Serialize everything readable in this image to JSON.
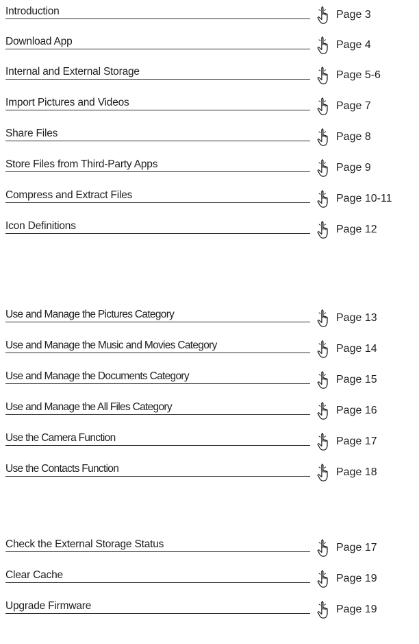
{
  "icon": "pointing-hand-icon",
  "groups": [
    {
      "entries": [
        {
          "title": "Introduction",
          "page": "Page 3"
        },
        {
          "title": "Download App",
          "page": "Page 4"
        },
        {
          "title": "Internal and External Storage",
          "page": "Page 5-6"
        },
        {
          "title": "Import Pictures and Videos",
          "page": "Page 7"
        },
        {
          "title": "Share Files",
          "page": "Page 8"
        },
        {
          "title": "Store Files from Third-Party Apps",
          "page": "Page 9"
        },
        {
          "title": "Compress and Extract Files",
          "page": "Page 10-11"
        },
        {
          "title": "Icon Definitions",
          "page": "Page 12"
        }
      ]
    },
    {
      "entries": [
        {
          "title": "Use and Manage the Pictures Category",
          "page": "Page 13"
        },
        {
          "title": "Use and Manage the Music and Movies Category",
          "page": "Page 14"
        },
        {
          "title": "Use and Manage the Documents Category",
          "page": "Page 15"
        },
        {
          "title": "Use and Manage the All Files Category",
          "page": "Page 16"
        },
        {
          "title": "Use the Camera Function",
          "page": "Page 17"
        },
        {
          "title": "Use the Contacts Function",
          "page": "Page 18"
        }
      ]
    },
    {
      "entries": [
        {
          "title": "Check the External Storage Status",
          "page": "Page 17"
        },
        {
          "title": "Clear Cache",
          "page": "Page 19"
        },
        {
          "title": "Upgrade Firmware",
          "page": "Page 19"
        }
      ]
    }
  ]
}
